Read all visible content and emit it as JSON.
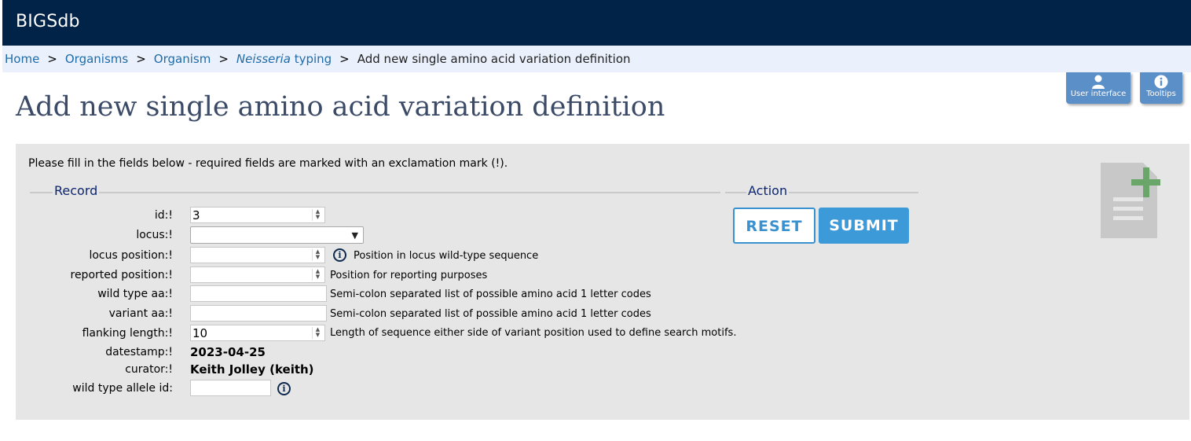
{
  "app": {
    "brand": "BIGSdb"
  },
  "breadcrumb": {
    "items": [
      {
        "label": "Home"
      },
      {
        "label": "Organisms"
      },
      {
        "label": "Organism"
      },
      {
        "label_italic": "Neisseria",
        "label_rest": " typing"
      }
    ],
    "separator": ">",
    "current": "Add new single amino acid variation definition"
  },
  "toolbar": {
    "user_interface_label": "User interface",
    "tooltips_label": "Tooltips"
  },
  "page": {
    "title": "Add new single amino acid variation definition"
  },
  "form": {
    "intro": "Please fill in the fields below - required fields are marked with an exclamation mark (!).",
    "record_legend": "Record",
    "action_legend": "Action",
    "fields": {
      "id": {
        "label": "id:!",
        "value": "3"
      },
      "locus": {
        "label": "locus:!",
        "value": ""
      },
      "locus_position": {
        "label": "locus position:!",
        "value": "",
        "hint": "Position in locus wild-type sequence"
      },
      "reported_position": {
        "label": "reported position:!",
        "value": "",
        "hint": "Position for reporting purposes"
      },
      "wild_type_aa": {
        "label": "wild type aa:!",
        "value": "",
        "hint": "Semi-colon separated list of possible amino acid 1 letter codes"
      },
      "variant_aa": {
        "label": "variant aa:!",
        "value": "",
        "hint": "Semi-colon separated list of possible amino acid 1 letter codes"
      },
      "flanking_length": {
        "label": "flanking length:!",
        "value": "10",
        "hint": "Length of sequence either side of variant position used to define search motifs."
      },
      "datestamp": {
        "label": "datestamp:!",
        "value": "2023-04-25"
      },
      "curator": {
        "label": "curator:!",
        "value": "Keith Jolley (keith)"
      },
      "wild_type_allele_id": {
        "label": "wild type allele id:",
        "value": ""
      }
    },
    "reset_label": "RESET",
    "submit_label": "SUBMIT"
  },
  "colors": {
    "topbar": "#002347",
    "breadcrumb_bg": "#eaf1fc",
    "link": "#1f6ca8",
    "title": "#3b4a66",
    "panel": "#e6e6e6",
    "legend": "#0c2570",
    "accent": "#3d9ad8",
    "tool_button": "#5b8fc7",
    "add_icon_green": "#6aa56a"
  },
  "icons": {
    "user": "user-icon",
    "info": "info-icon",
    "add_document": "add-document-icon"
  }
}
